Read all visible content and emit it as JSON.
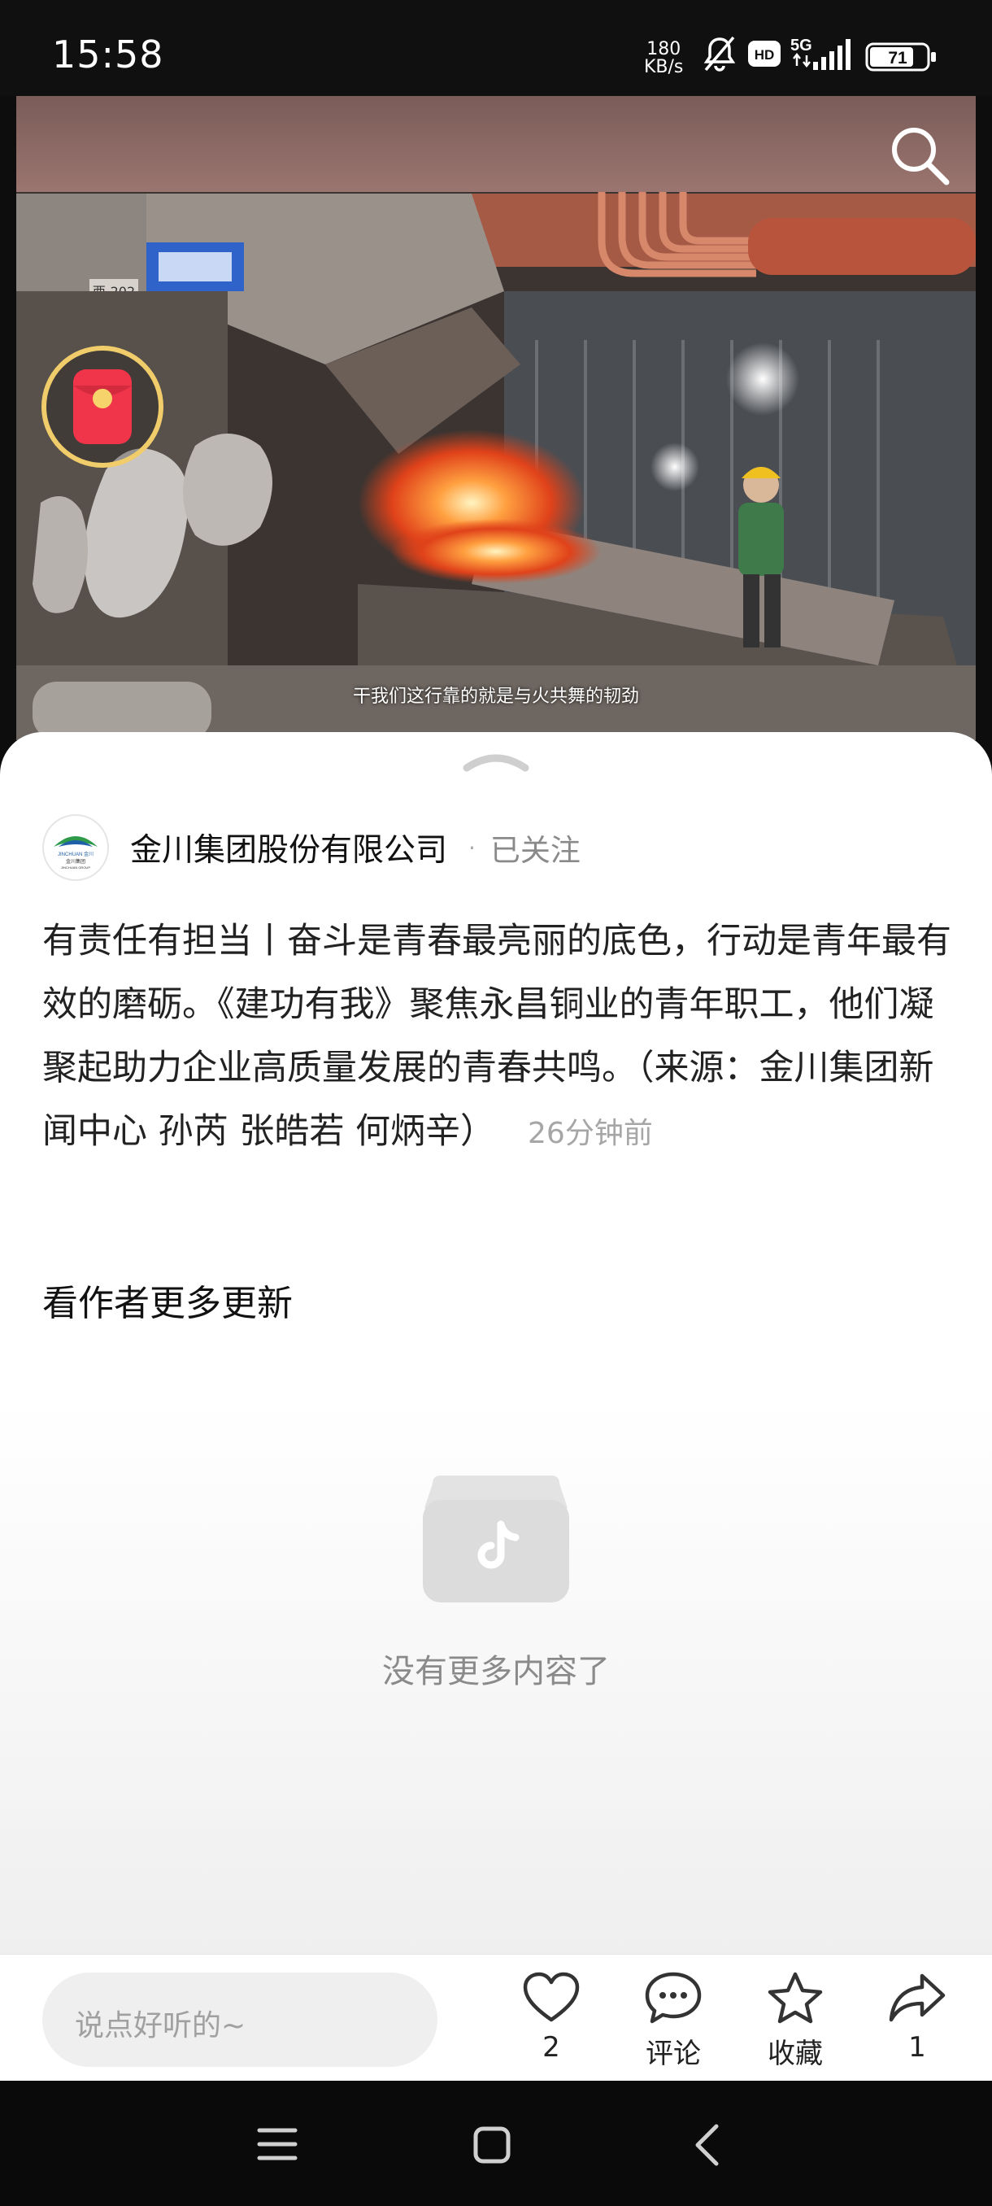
{
  "status_bar": {
    "time": "15:58",
    "network_speed_value": "180",
    "network_speed_unit": "KB/s",
    "hd_badge": "HD",
    "network_type": "5G",
    "battery": "71"
  },
  "video": {
    "subtitle": "干我们这行靠的就是与火共舞的韧劲",
    "sign_text": "西-202"
  },
  "post": {
    "author_name": "金川集团股份有限公司",
    "follow_separator": "·",
    "follow_status": "已关注",
    "avatar_logo_text": "JINCHUAN 金川",
    "avatar_logo_sub": "金川集团",
    "avatar_logo_sub2": "JINCHUAN GROUP",
    "description": "有责任有担当丨奋斗是青春最亮丽的底色，行动是青年最有效的磨砺。《建功有我》聚焦永昌铜业的青年职工，他们凝聚起助力企业高质量发展的青春共鸣。（来源：金川集团新闻中心 孙芮 张皓若 何炳辛）",
    "timestamp": "26分钟前"
  },
  "more": {
    "title": "看作者更多更新",
    "empty_text": "没有更多内容了"
  },
  "bottom_bar": {
    "comment_placeholder": "说点好听的~",
    "like_count": "2",
    "comment_label": "评论",
    "favorite_label": "收藏",
    "share_count": "1"
  },
  "colors": {
    "sheet_bg": "#ffffff",
    "red_packet": "#f0344a",
    "ring": "#f1cc6a"
  }
}
